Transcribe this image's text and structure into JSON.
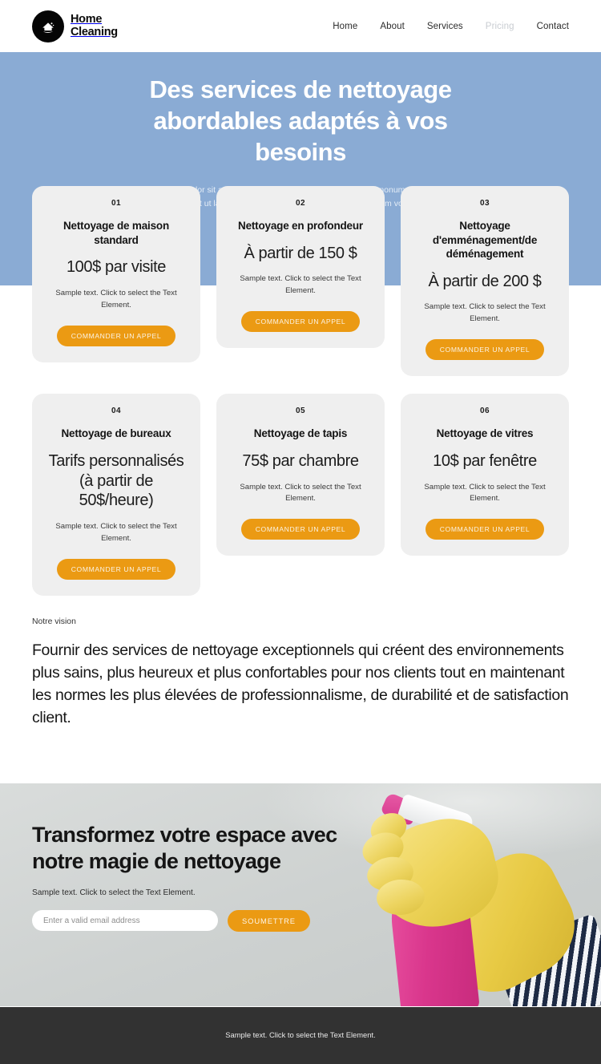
{
  "theme": {
    "hero_blue": "#8aabd4",
    "accent_orange": "#eb9a13",
    "card_gray": "#efefef",
    "footer_dark": "#323232",
    "promo_bg": "#d2d6d5"
  },
  "header": {
    "brand": {
      "line1": "Home",
      "line2": "Cleaning",
      "icon": "house-cleaning-logo-icon"
    },
    "nav": [
      {
        "label": "Home",
        "active": false
      },
      {
        "label": "About",
        "active": false
      },
      {
        "label": "Services",
        "active": false
      },
      {
        "label": "Pricing",
        "active": true
      },
      {
        "label": "Contact",
        "active": false
      }
    ]
  },
  "hero": {
    "title": "Des services de nettoyage abordables adaptés à vos besoins",
    "subtitle": "Lorem ipsum dolor sit amet, consetetur sadipscing elitr, sed diam nonumy eirmod tempor invidunt ut labore et dolore magna aliquyam erat, sed diam voluptua."
  },
  "pricing": {
    "button_label": "COMMANDER UN APPEL",
    "note": "Sample text. Click to select the Text Element.",
    "cards": [
      {
        "num": "01",
        "name": "Nettoyage de maison standard",
        "price": "100$ par visite"
      },
      {
        "num": "02",
        "name": "Nettoyage en profondeur",
        "price": "À partir de 150 $"
      },
      {
        "num": "03",
        "name": "Nettoyage d'emménagement/de déménagement",
        "price": "À partir de 200 $"
      },
      {
        "num": "04",
        "name": "Nettoyage de bureaux",
        "price": "Tarifs personnalisés (à partir de 50$/heure)"
      },
      {
        "num": "05",
        "name": "Nettoyage de tapis",
        "price": "75$ par chambre"
      },
      {
        "num": "06",
        "name": "Nettoyage de vitres",
        "price": "10$ par fenêtre"
      }
    ]
  },
  "vision": {
    "label": "Notre vision",
    "text": "Fournir des services de nettoyage exceptionnels qui créent des environnements plus sains, plus heureux et plus confortables pour nos clients tout en maintenant les normes les plus élevées de professionnalisme, de durabilité et de satisfaction client."
  },
  "promo": {
    "title": "Transformez votre espace avec notre magie de nettoyage",
    "note": "Sample text. Click to select the Text Element.",
    "email_placeholder": "Enter a valid email address",
    "email_value": "",
    "submit_label": "SOUMETTRE",
    "image_alt": "gloved-hand-holding-pink-spray-bottle-photo"
  },
  "footer": {
    "note": "Sample text. Click to select the Text Element."
  }
}
